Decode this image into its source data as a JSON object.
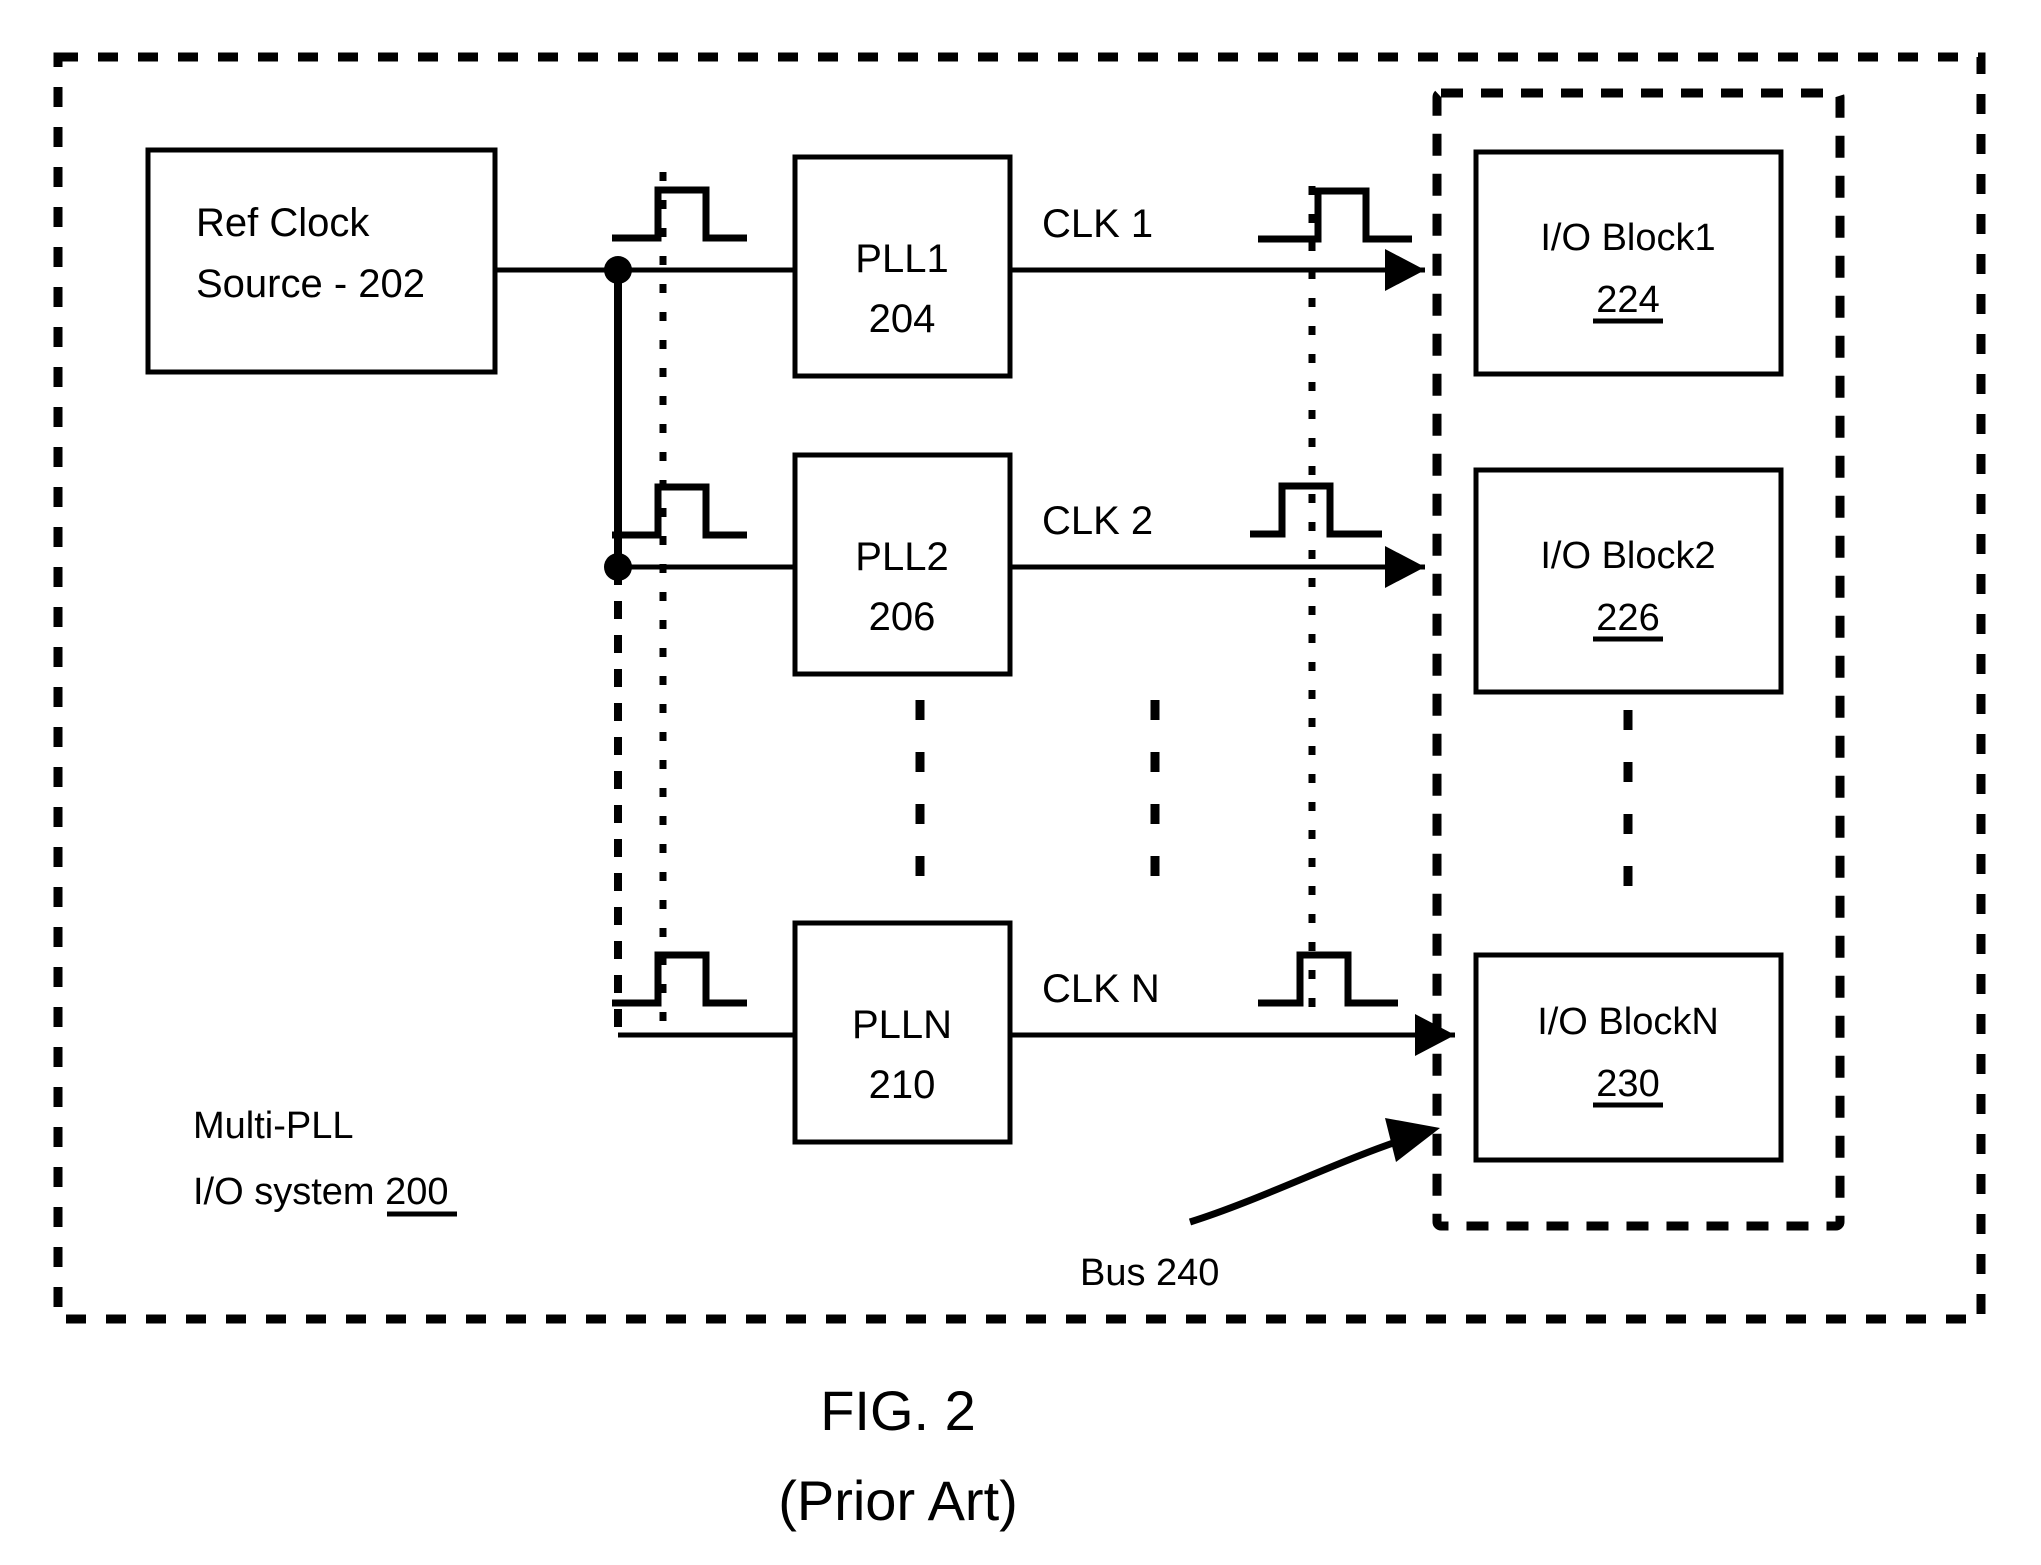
{
  "figure": {
    "caption_line1": "FIG. 2",
    "caption_line2": "(Prior Art)"
  },
  "system": {
    "name_line1": "Multi-PLL",
    "name_line2_text": "I/O system ",
    "name_line2_ref": "200"
  },
  "source_block": {
    "line1": "Ref Clock",
    "line2": "Source - 202"
  },
  "plls": [
    {
      "name": "PLL1",
      "ref": "204",
      "clk_label": "CLK 1"
    },
    {
      "name": "PLL2",
      "ref": "206",
      "clk_label": "CLK 2"
    },
    {
      "name": "PLLN",
      "ref": "210",
      "clk_label": "CLK N"
    }
  ],
  "io_blocks": [
    {
      "name": "I/O Block1",
      "ref": "224"
    },
    {
      "name": "I/O Block2",
      "ref": "226"
    },
    {
      "name": "I/O BlockN",
      "ref": "230"
    }
  ],
  "bus": {
    "label": "Bus 240"
  },
  "ellipsis": {
    "glyph": "⋮"
  },
  "colors": {
    "ink": "#000000",
    "paper": "#ffffff"
  }
}
